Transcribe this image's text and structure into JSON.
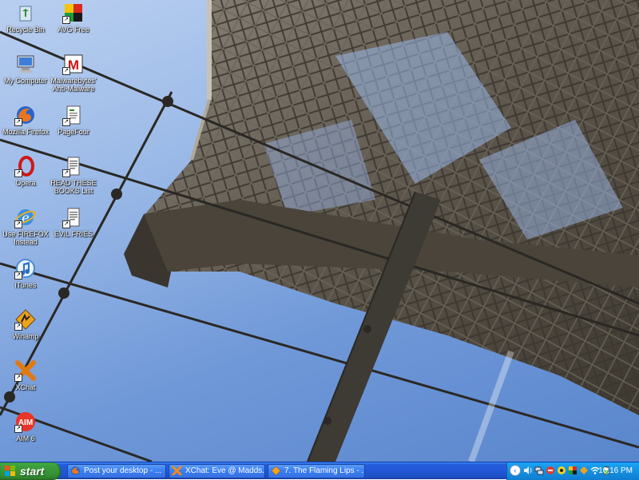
{
  "desktop": {
    "icons": [
      {
        "label": "Recycle Bin",
        "icon": "recycle-bin-icon"
      },
      {
        "label": "AVG Free",
        "icon": "avg-icon"
      },
      {
        "label": "My Computer",
        "icon": "my-computer-icon"
      },
      {
        "label": "Malwarebytes' Anti-Malware",
        "icon": "malwarebytes-icon"
      },
      {
        "label": "Mozilla Firefox",
        "icon": "firefox-icon"
      },
      {
        "label": "PageFour",
        "icon": "pagefour-icon"
      },
      {
        "label": "Opera",
        "icon": "opera-icon"
      },
      {
        "label": "READ THESE BOOKS List",
        "icon": "text-document-icon"
      },
      {
        "label": "Use FIREFOX Instead",
        "icon": "internet-explorer-icon"
      },
      {
        "label": "EVIL FRIES",
        "icon": "text-document-icon"
      },
      {
        "label": "iTunes",
        "icon": "itunes-icon"
      },
      {
        "label": "Winamp",
        "icon": "winamp-icon"
      },
      {
        "label": "XChat",
        "icon": "xchat-icon"
      },
      {
        "label": "AIM 6",
        "icon": "aim-icon"
      }
    ]
  },
  "taskbar": {
    "start_label": "start",
    "tasks": [
      {
        "label": "Post your desktop - ...",
        "icon": "firefox-icon"
      },
      {
        "label": "XChat: Eve @ Madds...",
        "icon": "xchat-icon"
      },
      {
        "label": "7. The Flaming Lips - ...",
        "icon": "winamp-icon"
      }
    ],
    "tray": {
      "chevron": "‹",
      "icons": [
        "sound-icon",
        "network-icon",
        "shield-icon",
        "aim-tray-icon",
        "avg-tray-icon",
        "winamp-tray-icon",
        "wireless-icon",
        "battery-icon"
      ],
      "clock": "10:16 PM"
    }
  },
  "colors": {
    "taskbar_blue": "#245edb",
    "start_green": "#3c9f3c",
    "tray_blue": "#1590e0",
    "sky": "#8fb2e6",
    "tower_steel": "#5c554c"
  }
}
